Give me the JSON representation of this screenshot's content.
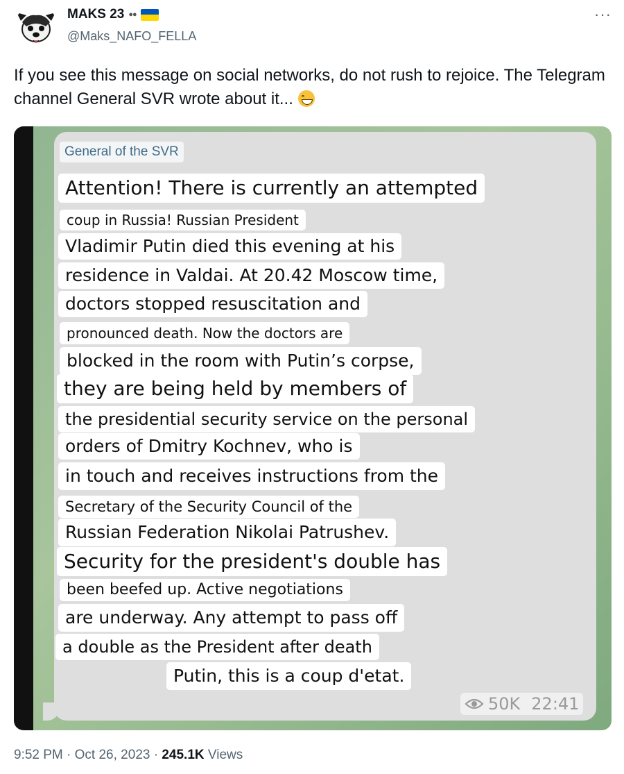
{
  "author": {
    "display_name": "MAKS 23",
    "handle": "@Maks_NAFO_FELLA",
    "avatar_icon": "fella-dog-avatar-icon",
    "eyes_icon": "eyes-icon",
    "flag_icon": "ukraine-flag-icon"
  },
  "more_icon": "more-options-icon",
  "tweet": {
    "text": "If you see this message on social networks, do not rush to rejoice.  The Telegram channel General SVR wrote about it...",
    "emoji": "grinning-face-icon"
  },
  "media": {
    "channel_name": "General of the SVR",
    "lines": [
      "Attention! There is currently an attempted",
      "coup in Russia! Russian President",
      "Vladimir Putin died this evening at his",
      "residence in Valdai. At 20.42 Moscow time,",
      "doctors stopped resuscitation and",
      "pronounced death. Now the doctors are",
      "blocked in the room with Putin’s corpse,",
      "they are being held by members of",
      "the presidential security service on the personal",
      "orders of Dmitry Kochnev, who is",
      "in touch and receives instructions from the",
      "Secretary of the Security Council of the",
      "Russian Federation Nikolai Patrushev.",
      "Security for the president's double has",
      "been beefed up. Active negotiations",
      "are underway. Any attempt to pass off",
      "a double as the President after death",
      "Putin, this is a coup d'etat."
    ],
    "views": "50K",
    "time": "22:41",
    "views_icon": "eye-icon"
  },
  "footer": {
    "time": "9:52 PM",
    "separator": "·",
    "date": "Oct 26, 2023",
    "views_count": "245.1K",
    "views_label": "Views"
  },
  "colors": {
    "text": "#0f1419",
    "muted": "#536471",
    "channel": "#3e6c88",
    "bubble": "#dedede",
    "background_green": "#95b98e"
  }
}
